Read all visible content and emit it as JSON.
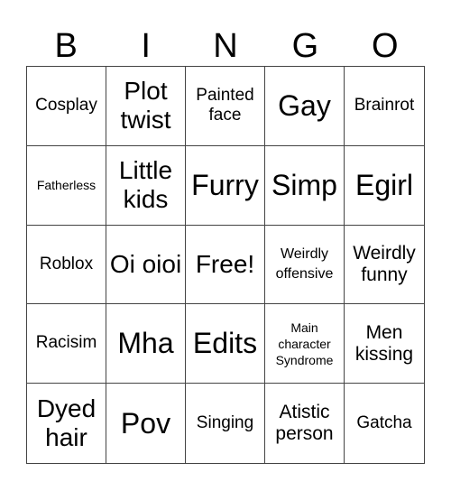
{
  "header": {
    "letters": [
      "B",
      "I",
      "N",
      "G",
      "O"
    ]
  },
  "cells": [
    {
      "text": "Cosplay"
    },
    {
      "text": "Plot twist"
    },
    {
      "text": "Painted face"
    },
    {
      "text": "Gay"
    },
    {
      "text": "Brainrot"
    },
    {
      "text": "Fatherless"
    },
    {
      "text": "Little kids"
    },
    {
      "text": "Furry"
    },
    {
      "text": "Simp"
    },
    {
      "text": "Egirl"
    },
    {
      "text": "Roblox"
    },
    {
      "text": "Oi oioi"
    },
    {
      "text": "Free!"
    },
    {
      "text": "Weirdly offensive"
    },
    {
      "text": "Weirdly funny"
    },
    {
      "text": "Racisim"
    },
    {
      "text": "Mha"
    },
    {
      "text": "Edits"
    },
    {
      "text": "Main character Syndrome"
    },
    {
      "text": "Men kissing"
    },
    {
      "text": "Dyed hair"
    },
    {
      "text": "Pov"
    },
    {
      "text": "Singing"
    },
    {
      "text": "Atistic person"
    },
    {
      "text": "Gatcha"
    }
  ]
}
